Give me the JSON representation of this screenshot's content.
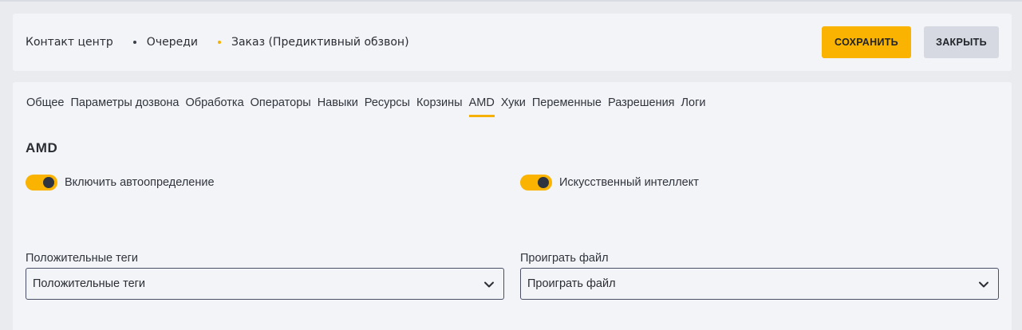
{
  "breadcrumb": {
    "items": [
      "Контакт центр",
      "Очереди",
      "Заказ (Предиктивный обзвон)"
    ]
  },
  "toolbar": {
    "save_label": "СОХРАНИТЬ",
    "close_label": "ЗАКРЫТЬ"
  },
  "tabs": [
    {
      "label": "Общее"
    },
    {
      "label": "Параметры дозвона"
    },
    {
      "label": "Обработка"
    },
    {
      "label": "Операторы"
    },
    {
      "label": "Навыки"
    },
    {
      "label": "Ресурсы"
    },
    {
      "label": "Корзины"
    },
    {
      "label": "AMD",
      "active": true
    },
    {
      "label": "Хуки"
    },
    {
      "label": "Переменные"
    },
    {
      "label": "Разрешения"
    },
    {
      "label": "Логи"
    }
  ],
  "section": {
    "title": "AMD",
    "toggles": [
      {
        "label": "Включить автоопределение",
        "on": true
      },
      {
        "label": "Искусственный интеллект",
        "on": true
      }
    ],
    "fields": [
      {
        "label": "Положительные теги",
        "value": "Положительные теги"
      },
      {
        "label": "Проиграть файл",
        "value": "Проиграть файл"
      }
    ]
  },
  "colors": {
    "accent": "#f9b300",
    "secondary_button": "#d6d9e1",
    "panel_bg": "#f3f4f8",
    "page_bg": "#e9ebef"
  }
}
